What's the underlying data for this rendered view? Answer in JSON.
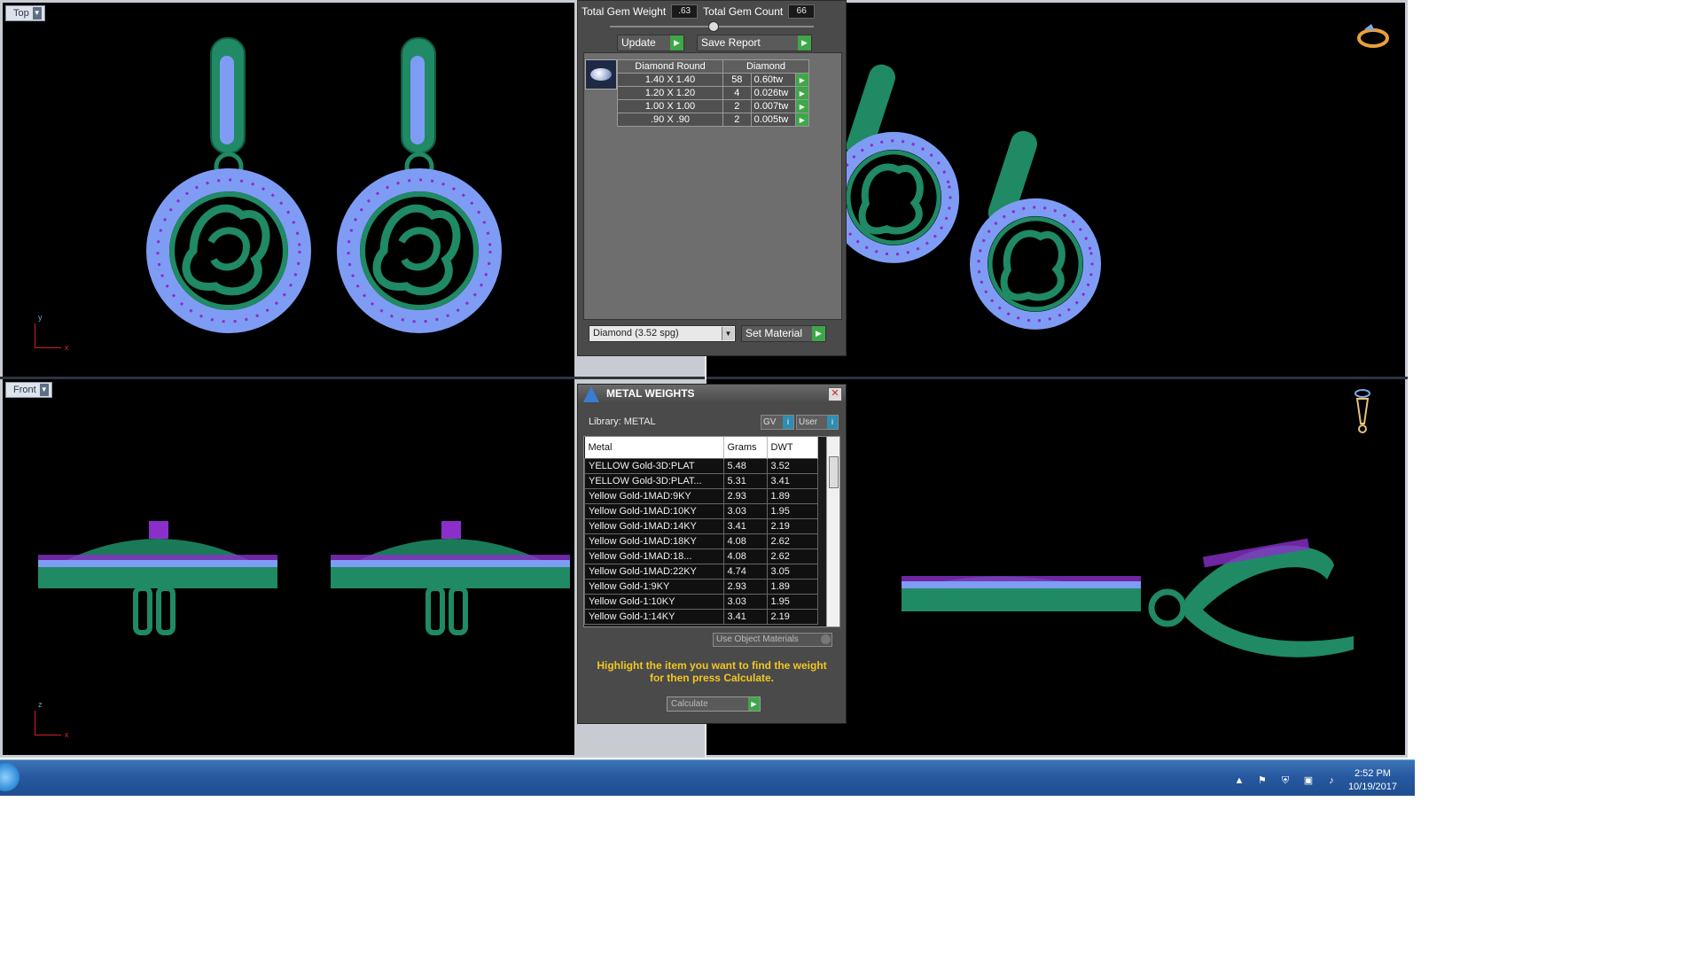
{
  "viewports": {
    "top_label": "Top",
    "front_label": "Front",
    "axis_y": "y",
    "axis_z": "z",
    "axis_x": "x"
  },
  "gem_panel": {
    "total_weight_label": "Total Gem Weight",
    "total_weight_value": ".63",
    "total_count_label": "Total Gem Count",
    "total_count_value": "66",
    "update_label": "Update",
    "save_report_label": "Save Report",
    "table_headers": [
      "Diamond Round",
      "Diamond"
    ],
    "rows": [
      {
        "size": "1.40 X 1.40",
        "count": "58",
        "weight": "0.60tw"
      },
      {
        "size": "1.20 X 1.20",
        "count": "4",
        "weight": "0.026tw"
      },
      {
        "size": "1.00 X 1.00",
        "count": "2",
        "weight": "0.007tw"
      },
      {
        "size": ".90 X .90",
        "count": "2",
        "weight": "0.005tw"
      }
    ],
    "material_select": "Diamond    (3.52 spg)",
    "set_material_label": "Set Material"
  },
  "metal_weights": {
    "title": "METAL WEIGHTS",
    "library_label": "Library: METAL",
    "gv_label": "GV",
    "user_label": "User",
    "headers": [
      "Metal",
      "Grams",
      "DWT"
    ],
    "rows": [
      {
        "metal": "YELLOW Gold-3D:PLAT",
        "grams": "5.48",
        "dwt": "3.52"
      },
      {
        "metal": "YELLOW Gold-3D:PLAT...",
        "grams": "5.31",
        "dwt": "3.41"
      },
      {
        "metal": "Yellow Gold-1MAD:9KY",
        "grams": "2.93",
        "dwt": "1.89"
      },
      {
        "metal": "Yellow Gold-1MAD:10KY",
        "grams": "3.03",
        "dwt": "1.95"
      },
      {
        "metal": "Yellow Gold-1MAD:14KY",
        "grams": "3.41",
        "dwt": "2.19"
      },
      {
        "metal": "Yellow Gold-1MAD:18KY",
        "grams": "4.08",
        "dwt": "2.62"
      },
      {
        "metal": "Yellow Gold-1MAD:18...",
        "grams": "4.08",
        "dwt": "2.62"
      },
      {
        "metal": "Yellow Gold-1MAD:22KY",
        "grams": "4.74",
        "dwt": "3.05"
      },
      {
        "metal": "Yellow Gold-1:9KY",
        "grams": "2.93",
        "dwt": "1.89"
      },
      {
        "metal": "Yellow Gold-1:10KY",
        "grams": "3.03",
        "dwt": "1.95"
      },
      {
        "metal": "Yellow Gold-1:14KY",
        "grams": "3.41",
        "dwt": "2.19"
      }
    ],
    "use_object_label": "Use Object Materials",
    "hint": "Highlight the item you want to find the weight for then press Calculate.",
    "calculate_label": "Calculate"
  },
  "taskbar": {
    "time": "2:52 PM",
    "date": "10/19/2017"
  },
  "colors": {
    "metal_green": "#1f8a63",
    "gem_blue": "#7f9cf5",
    "gem_purple": "#8a2fc9",
    "accent_green": "#3fa64a",
    "hint_yellow": "#f2c622"
  }
}
